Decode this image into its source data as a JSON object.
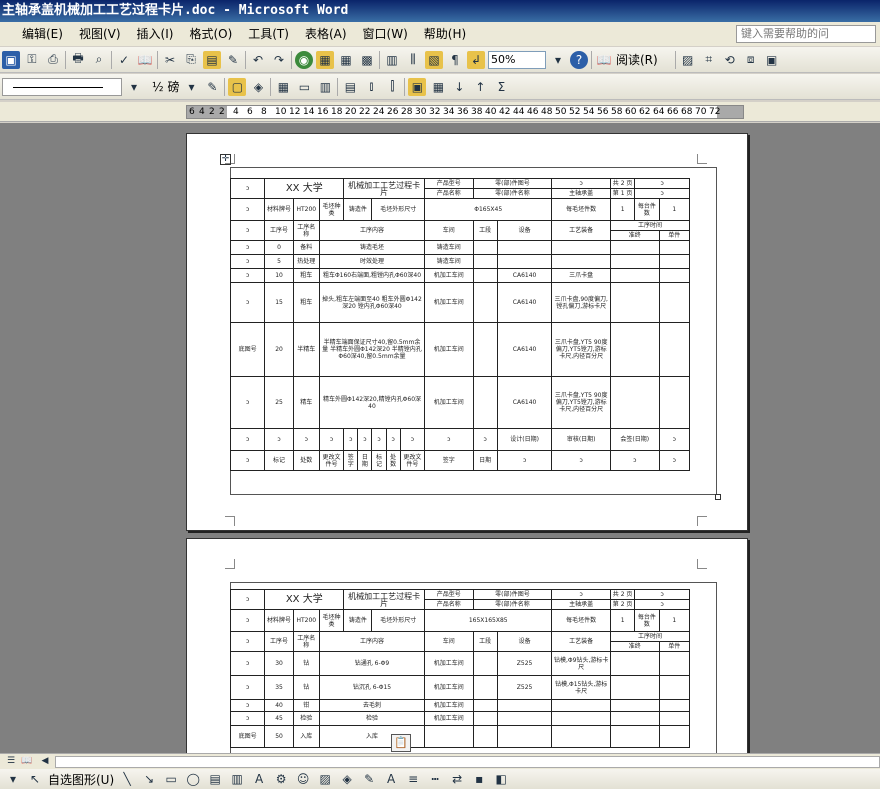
{
  "window": {
    "title": "主轴承盖机械加工工艺过程卡片.doc - Microsoft Word"
  },
  "menu": {
    "items": [
      "编辑(E)",
      "视图(V)",
      "插入(I)",
      "格式(O)",
      "工具(T)",
      "表格(A)",
      "窗口(W)",
      "帮助(H)"
    ],
    "ask_placeholder": "键入需要帮助的问"
  },
  "toolbar": {
    "zoom": "50%",
    "read_label": "阅读(R)",
    "pound_label": "½ 磅"
  },
  "ruler": {
    "labels": [
      "6",
      "4",
      "2",
      "2",
      "4",
      "6",
      "8",
      "10",
      "12",
      "14",
      "16",
      "18",
      "20",
      "22",
      "24",
      "26",
      "28",
      "30",
      "32",
      "34",
      "36",
      "38",
      "40",
      "42",
      "44",
      "46",
      "48",
      "50",
      "52",
      "54",
      "56",
      "58",
      "60",
      "62",
      "64",
      "66",
      "68",
      "70",
      "72"
    ]
  },
  "card": {
    "university": "XX 大学",
    "card_title": "机械加工工艺过程卡片",
    "product_type": "产品型号",
    "product_name": "产品名称",
    "part_no": "零(部)件图号",
    "part_name": "零(部)件名称",
    "main_cmpt": "主轴承盖",
    "total_pages": "共 2 页",
    "page_no": "第 1 页",
    "page_no2": "第 2 页",
    "material_no": "材料牌号",
    "material": "HT200",
    "blank_type": "毛坯种类",
    "cast": "铸造件",
    "blank_size": "毛坯外形尺寸",
    "blank_dim": "Φ165X45",
    "blank_dim2": "165X165X85",
    "pieces_blank": "每毛坯件数",
    "pieces_unit": "每台件数",
    "one": "1",
    "hdr": {
      "no": "工序号",
      "name": "工序名称",
      "content": "工序内容",
      "shop": "车间",
      "section": "工段",
      "equip": "设备",
      "tooling": "工艺装备",
      "time": "工序时间",
      "prep": "准终",
      "unit": "单件"
    },
    "rows": [
      {
        "no": "0",
        "name": "备料",
        "content": "铸造毛坯",
        "shop": "铸造车间",
        "equip": "",
        "tool": ""
      },
      {
        "no": "5",
        "name": "热处理",
        "content": "时效处理",
        "shop": "铸造车间",
        "equip": "",
        "tool": ""
      },
      {
        "no": "10",
        "name": "粗车",
        "content": "粗车Φ160右端面,粗镗内孔Φ60深40",
        "shop": "机加工车间",
        "equip": "CA6140",
        "tool": "三爪卡盘"
      },
      {
        "no": "15",
        "name": "粗车",
        "content": "掉头,粗车左端面至40 粗车外圆Φ142深20 镗内孔Φ60深40",
        "shop": "机加工车间",
        "equip": "CA6140",
        "tool": "三爪卡盘,90度偏刀,镗孔偏刀,游标卡尺"
      },
      {
        "no": "20",
        "name": "半精车",
        "content": "半精车端面保证尺寸40,留0.5mm余量 半精车外圆Φ142深20 半精镗内孔Φ60深40,留0.5mm余量",
        "shop": "机加工车间",
        "equip": "CA6140",
        "tool": "三爪卡盘,YT5 90度偏刀,YT5镗刀,游标卡尺,内径百分尺"
      },
      {
        "no": "25",
        "name": "精车",
        "content": "精车外圆Φ142深20,精镗内孔Φ60深40",
        "shop": "机加工车间",
        "equip": "CA6140",
        "tool": "三爪卡盘,YT5 90度偏刀,YT5镗刀,游标卡尺,内径百分尺"
      }
    ],
    "rows2": [
      {
        "no": "30",
        "name": "钻",
        "content": "钻通孔 6-Φ9",
        "shop": "机加工车间",
        "equip": "Z525",
        "tool": "钻模,Φ9钻头,游标卡尺"
      },
      {
        "no": "35",
        "name": "钻",
        "content": "钻沉孔 6-Φ15",
        "shop": "机加工车间",
        "equip": "Z525",
        "tool": "钻模,Φ15钻头,游标卡尺"
      },
      {
        "no": "40",
        "name": "钳",
        "content": "去毛刺",
        "shop": "机加工车间",
        "equip": "",
        "tool": ""
      },
      {
        "no": "45",
        "name": "检验",
        "content": "检验",
        "shop": "机加工车间",
        "equip": "",
        "tool": ""
      },
      {
        "no": "50",
        "name": "入库",
        "content": "入库",
        "shop": "",
        "equip": "",
        "tool": ""
      }
    ],
    "trace_no": "底图号",
    "design": "设计(日期)",
    "review": "审核(日期)",
    "sign": "会签(日期)",
    "mark": "标记",
    "count": "处数",
    "change_doc": "更改文件号",
    "signature": "签字",
    "date": "日期",
    "p": "ↄ"
  },
  "drawbar": {
    "autoshape": "自选图形(U)"
  }
}
